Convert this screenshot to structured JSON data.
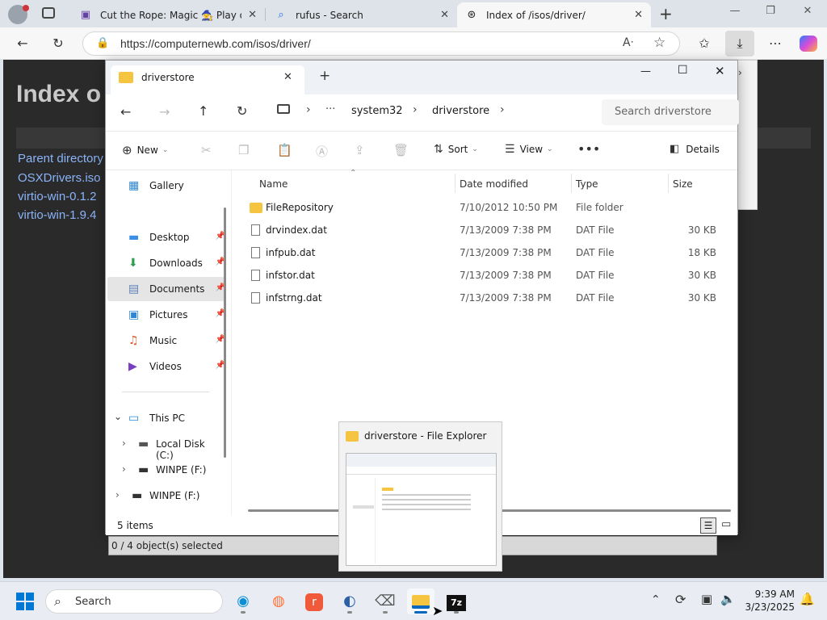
{
  "browser": {
    "tabs": [
      {
        "icon": "twitch-icon",
        "label": "Cut the Rope: Magic 🧙 Play on C"
      },
      {
        "icon": "search-icon",
        "label": "rufus - Search"
      },
      {
        "icon": "globe-icon",
        "label": "Index of /isos/driver/"
      }
    ],
    "url": "https://computernewb.com/isos/driver/"
  },
  "webpage": {
    "heading": "Index o",
    "links": [
      "Parent directory",
      "OSXDrivers.iso",
      "virtio-win-0.1.2",
      "virtio-win-1.9.4"
    ]
  },
  "explorer": {
    "tab_title": "driverstore",
    "breadcrumb": [
      "system32",
      "driverstore"
    ],
    "search_placeholder": "Search driverstore",
    "commands": {
      "new": "New",
      "sort": "Sort",
      "view": "View",
      "details": "Details"
    },
    "sidebar": {
      "gallery": "Gallery",
      "quick": [
        {
          "icon": "desktop-icon",
          "label": "Desktop"
        },
        {
          "icon": "downloads-icon",
          "label": "Downloads"
        },
        {
          "icon": "documents-icon",
          "label": "Documents"
        },
        {
          "icon": "pictures-icon",
          "label": "Pictures"
        },
        {
          "icon": "music-icon",
          "label": "Music"
        },
        {
          "icon": "videos-icon",
          "label": "Videos"
        }
      ],
      "this_pc": "This PC",
      "drives": [
        "Local Disk (C:)",
        "WINPE (F:)",
        "WINPE (F:)"
      ]
    },
    "columns": {
      "name": "Name",
      "date": "Date modified",
      "type": "Type",
      "size": "Size"
    },
    "files": [
      {
        "name": "FileRepository",
        "date": "7/10/2012 10:50 PM",
        "type": "File folder",
        "size": ""
      },
      {
        "name": "drvindex.dat",
        "date": "7/13/2009 7:38 PM",
        "type": "DAT File",
        "size": "30 KB"
      },
      {
        "name": "infpub.dat",
        "date": "7/13/2009 7:38 PM",
        "type": "DAT File",
        "size": "18 KB"
      },
      {
        "name": "infstor.dat",
        "date": "7/13/2009 7:38 PM",
        "type": "DAT File",
        "size": "30 KB"
      },
      {
        "name": "infstrng.dat",
        "date": "7/13/2009 7:38 PM",
        "type": "DAT File",
        "size": "30 KB"
      }
    ],
    "item_count": "5 items",
    "selection_status": "0 / 4 object(s) selected"
  },
  "thumbnail": {
    "title": "driverstore - File Explorer"
  },
  "taskbar": {
    "search": "Search",
    "time": "9:39 AM",
    "date": "3/23/2025",
    "accent": "#0067c0"
  }
}
